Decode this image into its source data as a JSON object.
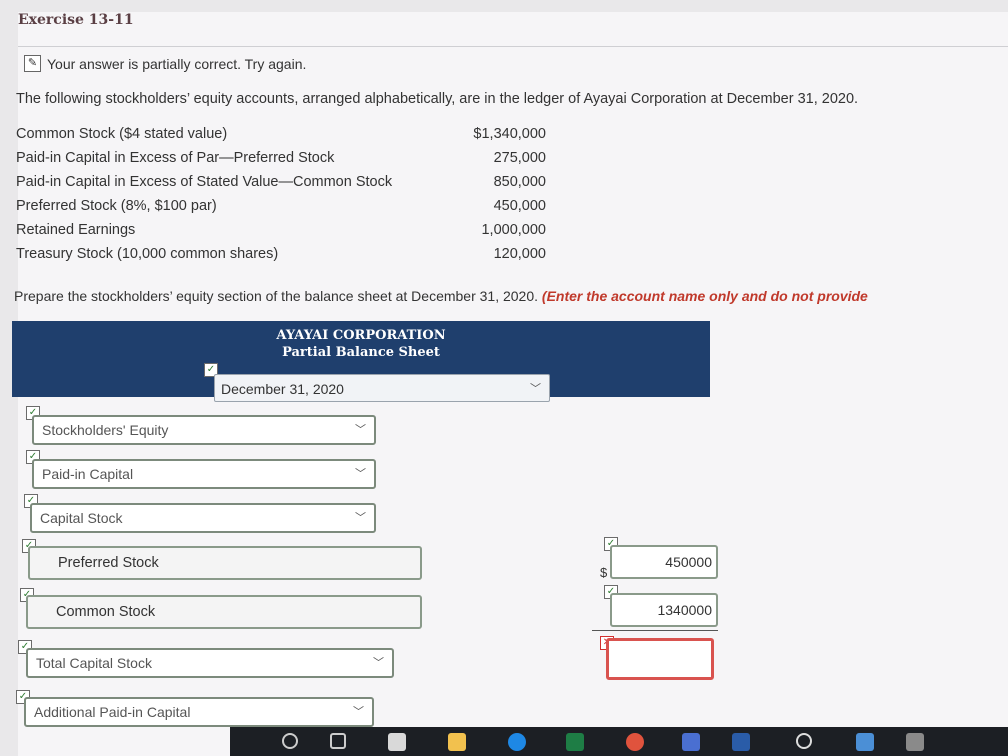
{
  "exercise_title": "Exercise 13-11",
  "status": {
    "icon": "pencil-icon",
    "message": "Your answer is partially correct.  Try again."
  },
  "intro": "The following stockholders’ equity accounts, arranged alphabetically, are in the ledger of Ayayai Corporation at December 31, 2020.",
  "ledger": [
    {
      "account": "Common Stock ($4 stated value)",
      "amount": "$1,340,000"
    },
    {
      "account": "Paid-in Capital in Excess of Par—Preferred Stock",
      "amount": "275,000"
    },
    {
      "account": "Paid-in Capital in Excess of Stated Value—Common Stock",
      "amount": "850,000"
    },
    {
      "account": "Preferred Stock (8%, $100 par)",
      "amount": "450,000"
    },
    {
      "account": "Retained Earnings",
      "amount": "1,000,000"
    },
    {
      "account": "Treasury Stock (10,000 common shares)",
      "amount": "120,000"
    }
  ],
  "prepare": {
    "text": "Prepare the stockholders’ equity section of the balance sheet at December 31, 2020.",
    "hint": "(Enter the account name only and do not provide"
  },
  "statement": {
    "company": "AYAYAI CORPORATION",
    "subtitle": "Partial Balance Sheet",
    "date_selected": "December 31, 2020"
  },
  "rows": {
    "stockholders_equity": "Stockholders' Equity",
    "paid_in_capital": "Paid-in Capital",
    "capital_stock": "Capital Stock",
    "preferred_stock": "Preferred Stock",
    "common_stock": "Common Stock",
    "total_capital_stock": "Total Capital Stock",
    "additional_paid_in": "Additional Paid-in Capital"
  },
  "amounts": {
    "currency_symbol": "$",
    "preferred_value": "450000",
    "common_value": "1340000",
    "total_value": ""
  },
  "colors": {
    "header_bg": "#1f3f6d",
    "hint_red": "#c0392b",
    "error_red": "#d9534f",
    "check_green": "#2e7d32"
  }
}
